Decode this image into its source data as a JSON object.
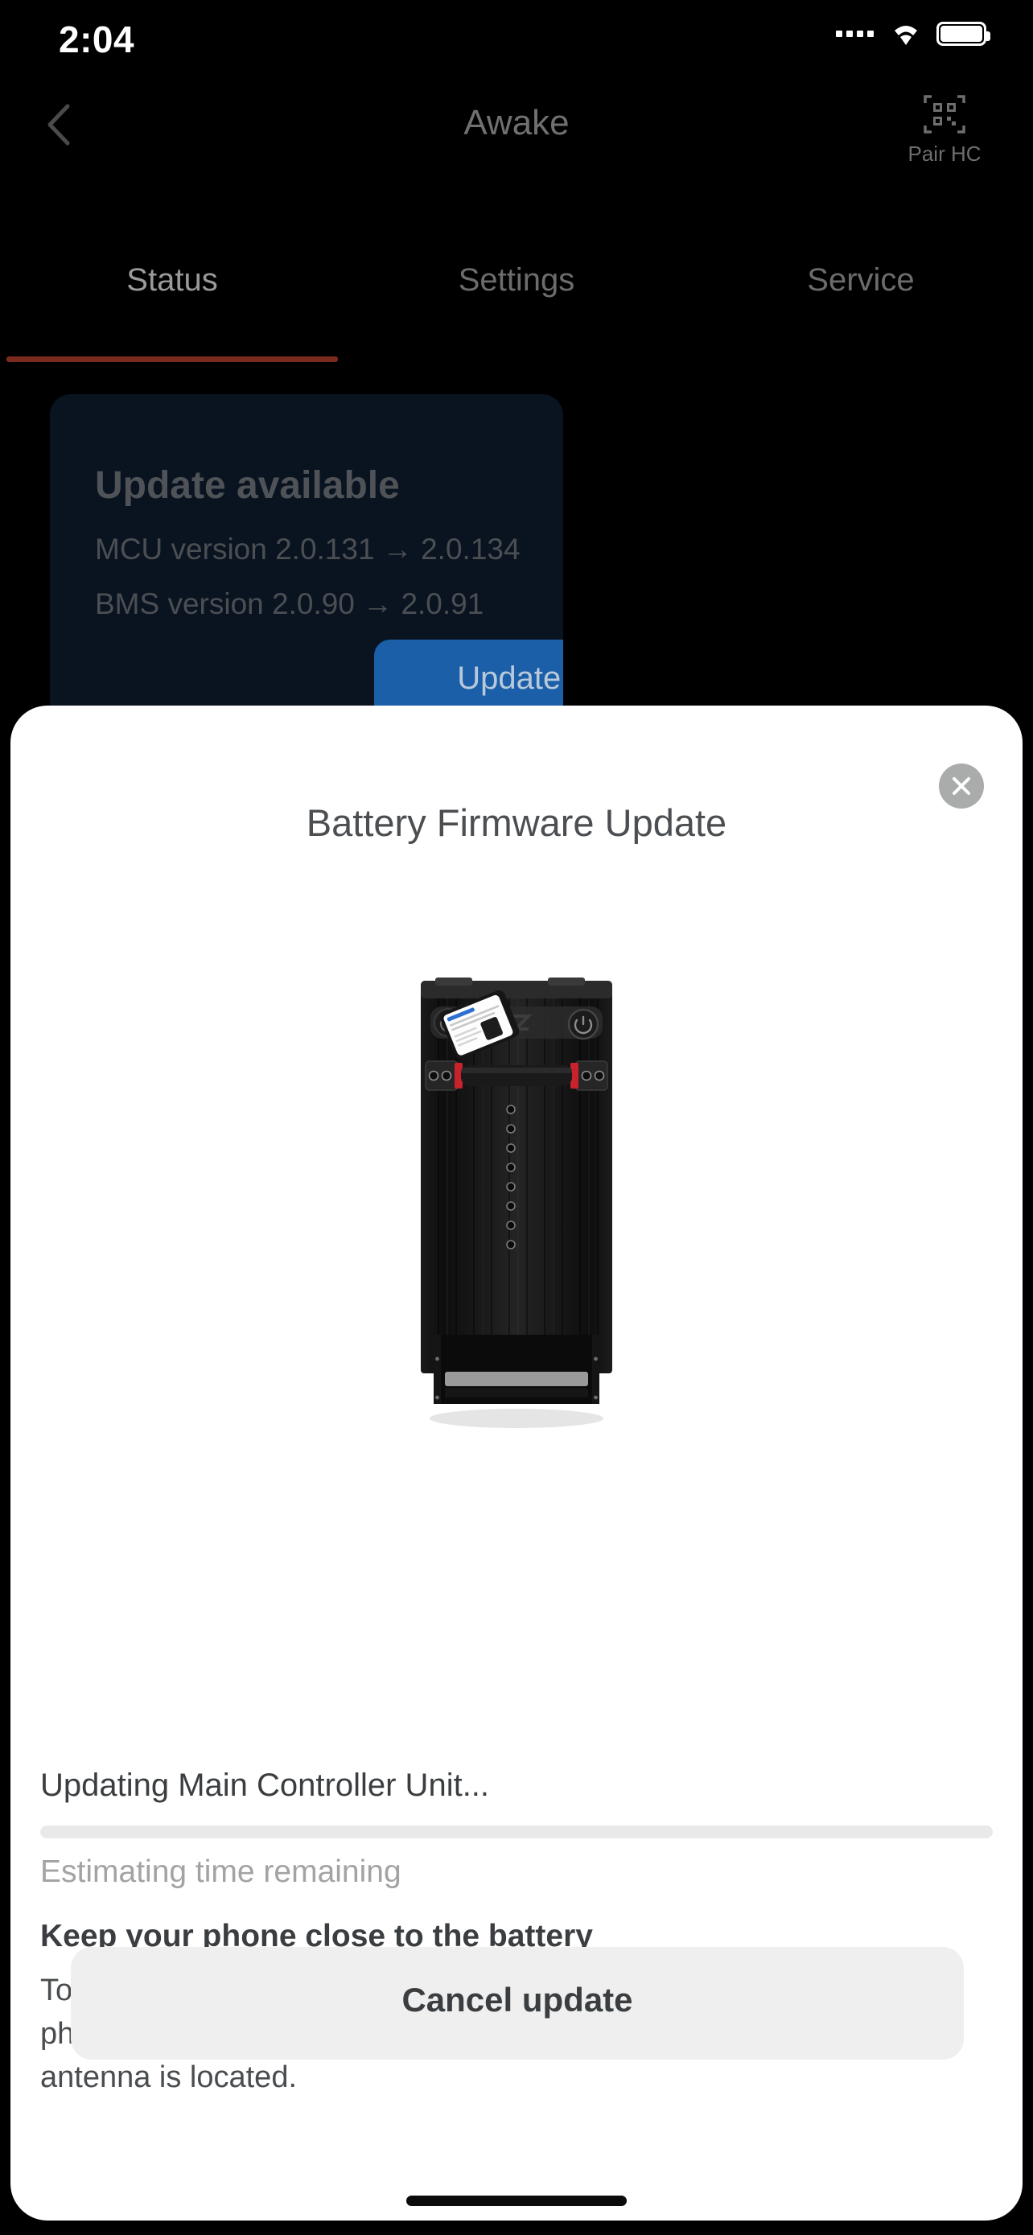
{
  "status_bar": {
    "time": "2:04",
    "signal_icon": "signal-dots-icon",
    "wifi_icon": "wifi-icon",
    "battery_icon": "battery-full-icon"
  },
  "header": {
    "back_icon": "chevron-left-icon",
    "title": "Awake",
    "action_icon": "qr-code-icon",
    "action_label": "Pair HC"
  },
  "tabs": [
    {
      "label": "Status",
      "active": true
    },
    {
      "label": "Settings",
      "active": false
    },
    {
      "label": "Service",
      "active": false
    }
  ],
  "update_card": {
    "title": "Update available",
    "mcu_version": "MCU version 2.0.131 → 2.0.134",
    "bms_version": "BMS version 2.0.90 → 2.0.91",
    "button_label": "Update now",
    "button_color": "#1a5fa8",
    "card_color": "#0a1420"
  },
  "modal": {
    "title": "Battery Firmware Update",
    "close_icon": "close-icon",
    "image_name": "battery-pack-with-phone-illustration",
    "progress": {
      "label": "Updating Main Controller Unit...",
      "percent": 0,
      "eta_text": "Estimating time remaining"
    },
    "advice": {
      "heading": "Keep your phone close to the battery",
      "body": "To ensure fast and stable connection during the firmware upload phase, make sure your phone is near battery LEDs where receiver antenna is located."
    },
    "cancel_label": "Cancel update"
  },
  "accent_colors": {
    "tab_underline": "#7b2a1e",
    "primary_button": "#1a5fa8",
    "sheet_background": "#ffffff"
  }
}
